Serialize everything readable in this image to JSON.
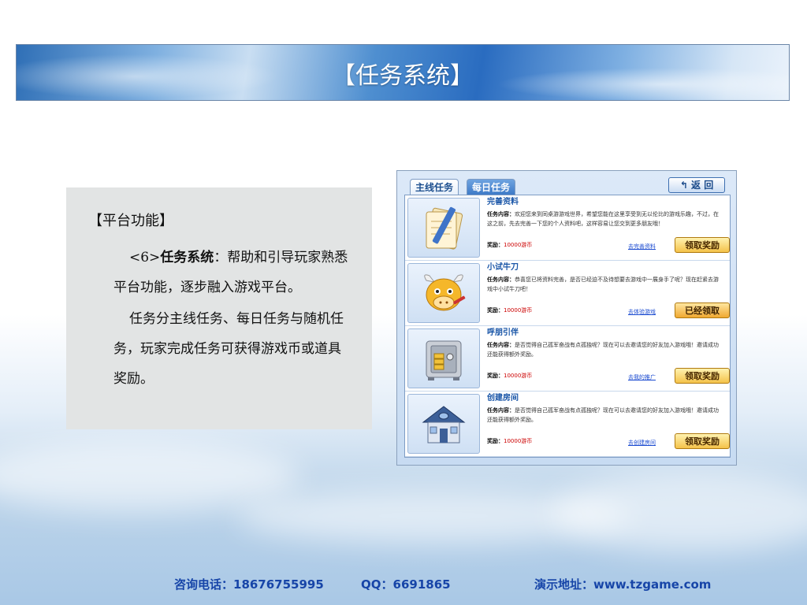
{
  "banner": {
    "title": "【任务系统】"
  },
  "info": {
    "heading": "【平台功能】",
    "para1_prefix": "<6>",
    "para1_bold": "任务系统",
    "para1_rest": "：帮助和引导玩家熟悉平台功能，逐步融入游戏平台。",
    "para2": "任务分主线任务、每日任务与随机任务，玩家完成任务可获得游戏币或道具奖励。"
  },
  "app": {
    "tabs": [
      {
        "label": "主线任务"
      },
      {
        "label": "每日任务"
      }
    ],
    "back_label": "↰ 返 回",
    "content_label": "任务内容：",
    "reward_label": "奖励：",
    "tasks": [
      {
        "title": "完善资料",
        "icon": "document-pen-icon",
        "desc": "欢迎您来到同桌游游戏世界，希望您能在这里享受到无以伦比的游戏乐趣，不过，在这之前，先去完善一下您的个人资料吧，这样容易让您交到更多朋友哦！",
        "reward": "10000游币",
        "link": "去完善资料",
        "button": "领取奖励"
      },
      {
        "title": "小试牛刀",
        "icon": "bull-mascot-icon",
        "desc": "恭喜您已将资料完善，是否已经迫不及待想要去游戏中一展身手了呢？现在赶紧去游戏中小试牛刀吧！",
        "reward": "10000游币",
        "link": "去体验游戏",
        "button": "已经领取"
      },
      {
        "title": "呼朋引伴",
        "icon": "safe-box-icon",
        "desc": "是否觉得自己孤军奋战有点孤独呢？现在可以去邀请您的好友加入游戏哦！邀请成功还能获得额外奖励。",
        "reward": "10000游币",
        "link": "去我的推广",
        "button": "领取奖励"
      },
      {
        "title": "创建房间",
        "icon": "house-icon",
        "desc": "是否觉得自己孤军奋战有点孤独呢？现在可以去邀请您的好友加入游戏哦！邀请成功还能获得额外奖励。",
        "reward": "10000游币",
        "link": "去创建房间",
        "button": "领取奖励"
      }
    ]
  },
  "footer": {
    "phone": "咨询电话：18676755995",
    "qq": "QQ：6691865",
    "demo": "演示地址：www.tzgame.com"
  }
}
